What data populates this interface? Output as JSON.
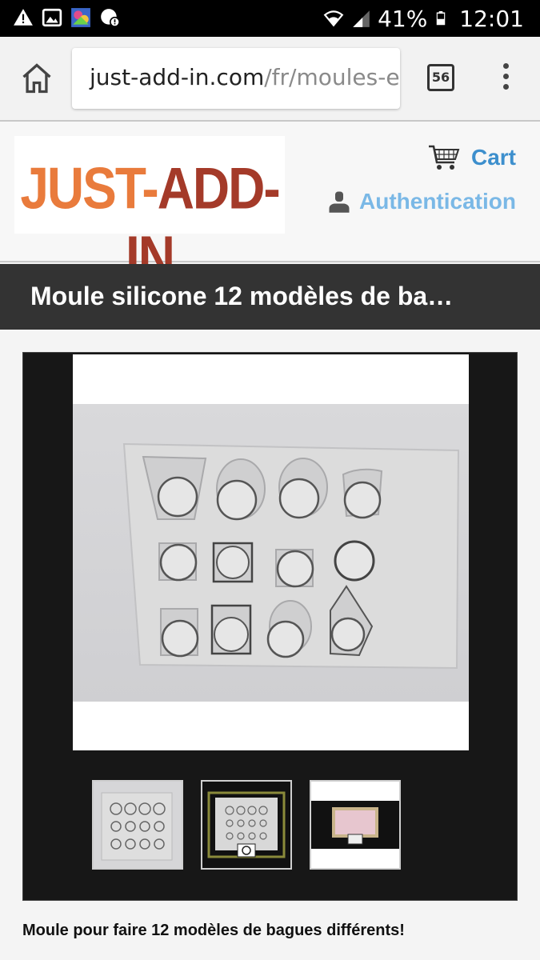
{
  "status_bar": {
    "battery": "41%",
    "time": "12:01",
    "left_icons": [
      "warning-icon",
      "image-icon",
      "app-thumbnail-icon",
      "data-saver-icon"
    ],
    "right_icons": [
      "wifi-icon",
      "signal-icon",
      "battery-icon"
    ]
  },
  "browser": {
    "url_host": "just-add-in.com",
    "url_path": "/fr/moules-e",
    "tab_count": "56",
    "icons": [
      "home-icon",
      "tabs-icon",
      "menu-dots-icon"
    ]
  },
  "header": {
    "logo_part1": "JUST-",
    "logo_part2": "ADD-IN",
    "cart_label": "Cart",
    "auth_label": "Authentication",
    "colors": {
      "link": "#3d8fcd",
      "link_light": "#7ab8e6",
      "logo_orange": "#e97b3c",
      "logo_red": "#a43a29"
    }
  },
  "product": {
    "title": "Moule silicone 12 modèles de ba…",
    "description": "Moule pour faire 12 modèles de bagues différents!",
    "thumbnails": 3
  }
}
